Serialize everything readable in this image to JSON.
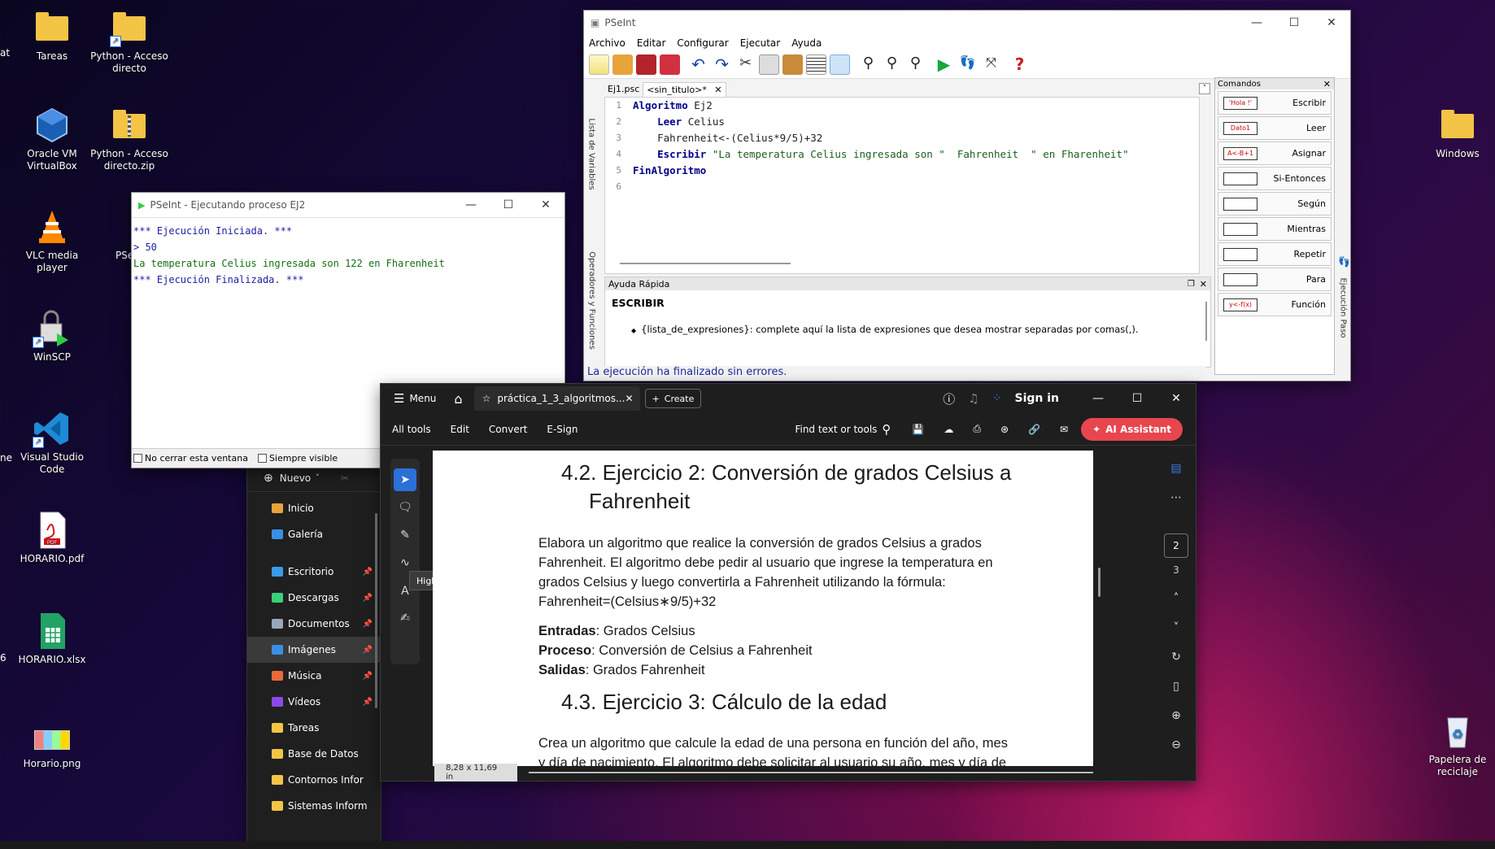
{
  "desktop": {
    "icons": [
      {
        "label": "Tareas"
      },
      {
        "label": "Python - Acceso directo"
      },
      {
        "label": "Oracle VM VirtualBox"
      },
      {
        "label": "Python - Acceso directo.zip"
      },
      {
        "label": "VLC media player"
      },
      {
        "label": "WinSCP"
      },
      {
        "label": "Visual Studio Code"
      },
      {
        "label": "HORARIO.pdf"
      },
      {
        "label": "HORARIO.xlsx"
      },
      {
        "label": "Horario.png"
      },
      {
        "label": "Windows"
      },
      {
        "label": "Papelera de reciclaje"
      }
    ],
    "partial_left_texts": [
      "at",
      "ne",
      "6"
    ],
    "partial_pse": "PSe"
  },
  "pseint_main": {
    "title": "PSeInt",
    "menu": [
      "Archivo",
      "Editar",
      "Configurar",
      "Ejecutar",
      "Ayuda"
    ],
    "tabs": [
      "Ej1.psc",
      "<sin_titulo>*"
    ],
    "side_labels": {
      "left_top": "Lista de Variables",
      "left_bottom": "Operadores y Funciones",
      "right": "Ejecución Paso"
    },
    "code_lines": [
      {
        "n": "1",
        "kw": "Algoritmo",
        "rest": " Ej2",
        "indent": ""
      },
      {
        "n": "2",
        "kw": "Leer",
        "rest": " Celius",
        "indent": "    "
      },
      {
        "n": "3",
        "kw": "",
        "rest": "Fahrenheit<-(Celius*9/5)+32",
        "indent": "    "
      },
      {
        "n": "4",
        "kw": "Escribir",
        "rest": " \"La temperatura Celius ingresada son \"  Fahrenheit  \" en Fharenheit\"",
        "indent": "    "
      },
      {
        "n": "5",
        "kw": "FinAlgoritmo",
        "rest": "",
        "indent": ""
      },
      {
        "n": "6",
        "kw": "",
        "rest": "",
        "indent": ""
      }
    ],
    "help_title": "Ayuda Rápida",
    "help_heading": "ESCRIBIR",
    "help_text": "{lista_de_expresiones}: complete aquí la lista de expresiones que desea mostrar separadas por comas(,).",
    "status": "La ejecución ha finalizado sin errores.",
    "commands_title": "Comandos",
    "commands": [
      {
        "shape": "'Hola !'",
        "label": "Escribir"
      },
      {
        "shape": "Dato1",
        "label": "Leer"
      },
      {
        "shape": "A<-B+1",
        "label": "Asignar"
      },
      {
        "shape": "",
        "label": "Si-Entonces"
      },
      {
        "shape": "",
        "label": "Según"
      },
      {
        "shape": "",
        "label": "Mientras"
      },
      {
        "shape": "",
        "label": "Repetir"
      },
      {
        "shape": "",
        "label": "Para"
      },
      {
        "shape": "y<-f(x)",
        "label": "Función"
      }
    ]
  },
  "pseint_exec": {
    "title": "PSeInt - Ejecutando proceso EJ2",
    "lines": [
      {
        "text": "*** Ejecución Iniciada. ***",
        "color": "#1c1ca8"
      },
      {
        "text": "> 50",
        "color": "#1c1ca8"
      },
      {
        "text": "La temperatura Celius ingresada son 122 en Fharenheit",
        "color": "#107010"
      },
      {
        "text": "*** Ejecución Finalizada. ***",
        "color": "#1c1ca8"
      }
    ],
    "chk_keep": "No cerrar esta ventana",
    "chk_visible": "Siempre visible"
  },
  "explorer": {
    "new_label": "Nuevo",
    "items": [
      {
        "label": "Inicio",
        "color": "#e8a33a",
        "pin": false
      },
      {
        "label": "Galería",
        "color": "#3a8ee8",
        "pin": false
      },
      {
        "label": "Escritorio",
        "color": "#3a9be8",
        "pin": true
      },
      {
        "label": "Descargas",
        "color": "#3ad07a",
        "pin": true
      },
      {
        "label": "Documentos",
        "color": "#9aa7b8",
        "pin": true
      },
      {
        "label": "Imágenes",
        "color": "#3a8ee8",
        "pin": true,
        "selected": true
      },
      {
        "label": "Música",
        "color": "#e86a3a",
        "pin": true
      },
      {
        "label": "Vídeos",
        "color": "#8a4ae8",
        "pin": true
      },
      {
        "label": "Tareas",
        "color": "#f3c445",
        "pin": false
      },
      {
        "label": "Base de Datos",
        "color": "#f3c445",
        "pin": false
      },
      {
        "label": "Contornos Infor",
        "color": "#f3c445",
        "pin": false
      },
      {
        "label": "Sistemas Inform",
        "color": "#f3c445",
        "pin": false
      }
    ]
  },
  "acrobat": {
    "menu": "Menu",
    "tab_title": "práctica_1_3_algoritmos...",
    "create": "Create",
    "sign_in": "Sign in",
    "toolbar": [
      "All tools",
      "Edit",
      "Convert",
      "E-Sign"
    ],
    "find": "Find text or tools",
    "ai": "AI Assistant",
    "tooltip": "Highlight selected text",
    "page_size": "8,28 x 11,69 in",
    "pages": [
      "2",
      "3"
    ],
    "doc": {
      "h1_num": "4.2.",
      "h1_line1": "Ejercicio 2: Conversión de grados Celsius a",
      "h1_line2": "Fahrenheit",
      "p1": [
        "Elabora un algoritmo que realice la conversión de grados Celsius a grados",
        "Fahrenheit. El algoritmo debe pedir al usuario que ingrese la temperatura en",
        "grados Celsius y luego convertirla a Fahrenheit utilizando la fórmula:",
        "Fahrenheit=(Celsius∗9/5)+32"
      ],
      "entradas_k": "Entradas",
      "entradas_v": ": Grados Celsius",
      "proceso_k": "Proceso",
      "proceso_v": ": Conversión de Celsius a Fahrenheit",
      "salidas_k": "Salidas",
      "salidas_v": ": Grados Fahrenheit",
      "h2": "4.3. Ejercicio 3: Cálculo de la edad",
      "p2": [
        "Crea un algoritmo que calcule la edad de una persona en función del año, mes",
        "y día de nacimiento. El algoritmo debe solicitar al usuario su año, mes y día de"
      ]
    }
  }
}
